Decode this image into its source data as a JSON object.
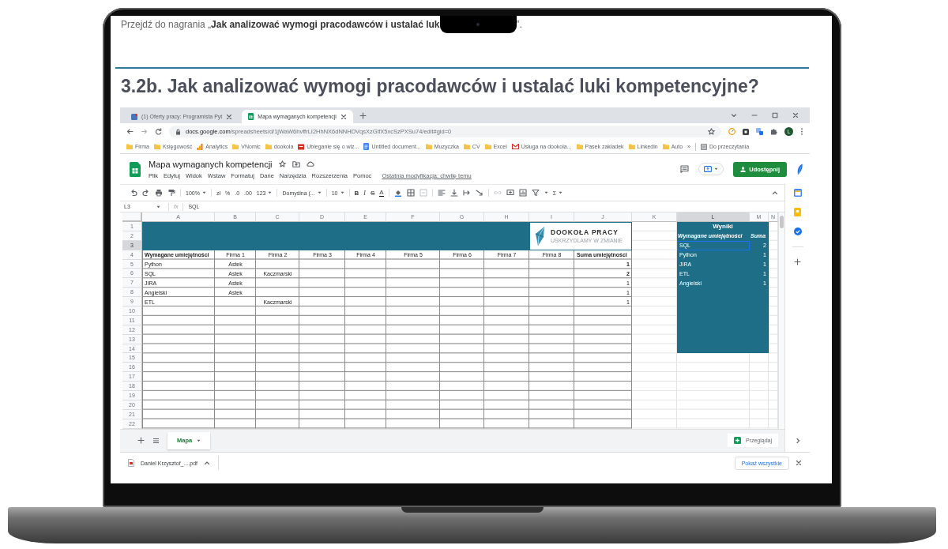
{
  "intro": {
    "text": "Przejdź do nagrania „**Jak analizować wymogi pracodawców i ustalać luk**",
    "end": "”."
  },
  "heading": "3.2b. Jak analizować wymogi pracodawców i ustalać luki kompetencyjne?",
  "browser": {
    "tabs": [
      {
        "title": "(1) Oferty pracy: Programista Pyt",
        "selected": false
      },
      {
        "title": "Mapa wymaganych kompetencji",
        "selected": true
      }
    ],
    "url": {
      "host": "docs.google.com",
      "path": "/spreadsheets/d/1jWaW6hvffrLI2HhNX6dNNHDVqsXzGlfX5xcSzPXSu74/edit#gid=0"
    },
    "profile_initial": "L",
    "bookmarks": [
      {
        "label": "Firma",
        "kind": "folder"
      },
      {
        "label": "Księgowość",
        "kind": "folder"
      },
      {
        "label": "Analytics",
        "kind": "analytics"
      },
      {
        "label": "VNomic",
        "kind": "folder"
      },
      {
        "label": "dookola",
        "kind": "folder"
      },
      {
        "label": "Ubieganie się o wiz...",
        "kind": "page"
      },
      {
        "label": "Untitled document...",
        "kind": "doc"
      },
      {
        "label": "Muzyczka",
        "kind": "folder"
      },
      {
        "label": "CV",
        "kind": "folder"
      },
      {
        "label": "Excel",
        "kind": "folder"
      },
      {
        "label": "Usługa na dookola...",
        "kind": "mail"
      },
      {
        "label": "Pasek zakładek",
        "kind": "folder"
      },
      {
        "label": "Linkedin",
        "kind": "folder"
      },
      {
        "label": "Auto",
        "kind": "folder"
      }
    ],
    "bookmarks_more": "»",
    "reading_list": "Do przeczytania"
  },
  "sheet": {
    "title": "Mapa wymaganych kompetencji",
    "menu": [
      "Plik",
      "Edytuj",
      "Widok",
      "Wstaw",
      "Formatuj",
      "Dane",
      "Narzędzia",
      "Rozszerzenia",
      "Pomoc"
    ],
    "last_edit": "Ostatnia modyfikacja: chwilę temu",
    "share": "Udostępnij",
    "toolbar": {
      "zoom": "100%",
      "currency": "zł",
      "percent": "%",
      "decimals_less": ".0",
      "decimals_more": ".00",
      "number_format": "123",
      "font": "Domyślna (...",
      "font_size": "10",
      "bold": "B",
      "italic": "I",
      "strikethrough": "S",
      "text_color": "A",
      "functions": "Σ"
    },
    "name_box": "L3",
    "formula_icon": "fx",
    "formula": "SQL",
    "columns": [
      {
        "label": "A",
        "selected": false
      },
      {
        "label": "B",
        "selected": false
      },
      {
        "label": "C",
        "selected": false
      },
      {
        "label": "D",
        "selected": false
      },
      {
        "label": "E",
        "selected": false
      },
      {
        "label": "F",
        "selected": false
      },
      {
        "label": "G",
        "selected": false
      },
      {
        "label": "H",
        "selected": false
      },
      {
        "label": "I",
        "selected": false
      },
      {
        "label": "J",
        "selected": false
      },
      {
        "label": "K",
        "selected": false
      },
      {
        "label": "L",
        "selected": true
      },
      {
        "label": "M",
        "selected": false
      },
      {
        "label": "N",
        "selected": false
      }
    ],
    "row_numbers": [
      {
        "label": "1",
        "selected": false
      },
      {
        "label": "2",
        "selected": false
      },
      {
        "label": "3",
        "selected": true
      },
      {
        "label": "4",
        "selected": false
      },
      {
        "label": "5",
        "selected": false
      },
      {
        "label": "6",
        "selected": false
      },
      {
        "label": "7",
        "selected": false
      },
      {
        "label": "8",
        "selected": false
      },
      {
        "label": "9",
        "selected": false
      },
      {
        "label": "10",
        "selected": false
      },
      {
        "label": "11",
        "selected": false
      },
      {
        "label": "12",
        "selected": false
      },
      {
        "label": "13",
        "selected": false
      },
      {
        "label": "14",
        "selected": false
      },
      {
        "label": "15",
        "selected": false
      },
      {
        "label": "16",
        "selected": false
      },
      {
        "label": "17",
        "selected": false
      },
      {
        "label": "18",
        "selected": false
      },
      {
        "label": "19",
        "selected": false
      },
      {
        "label": "20",
        "selected": false
      },
      {
        "label": "21",
        "selected": false
      },
      {
        "label": "22",
        "selected": false
      }
    ],
    "table": {
      "headers": [
        "Wymagane umiejętności",
        "Firma 1",
        "Firma 2",
        "Firma 3",
        "Firma 4",
        "Firma 5",
        "Firma 6",
        "Firma 7",
        "Firma 8",
        "Suma umiejętności"
      ],
      "rows": [
        {
          "skill": "Python",
          "firma_1": "Astek",
          "sum": "1",
          "sum_bold": true
        },
        {
          "skill": "SQL",
          "firma_1": "Astek",
          "firma_2": "Kaczmarski",
          "sum": "2",
          "sum_bold": true
        },
        {
          "skill": "JIRA",
          "firma_1": "Astek",
          "sum": "1",
          "sum_bold": false
        },
        {
          "skill": "Angielski",
          "firma_1": "Astek",
          "sum": "1",
          "sum_bold": false
        },
        {
          "skill": "ETL",
          "firma_2": "Kaczmarski",
          "sum": "1",
          "sum_bold": false
        }
      ]
    },
    "logo": {
      "name": "DOOKOŁA PRACY",
      "tagline": "USKRZYDLAMY W ZMIANIE"
    },
    "results": {
      "title": "Wyniki",
      "headers": [
        "Wymagane umiejętności",
        "Suma"
      ],
      "rows": [
        {
          "skill": "SQL",
          "sum": "2",
          "selected": true
        },
        {
          "skill": "Python",
          "sum": "1",
          "selected": false
        },
        {
          "skill": "JIRA",
          "sum": "1",
          "selected": false
        },
        {
          "skill": "ETL",
          "sum": "1",
          "selected": false
        },
        {
          "skill": "Angielski",
          "sum": "1",
          "selected": false
        }
      ]
    },
    "sheet_tabs": [
      {
        "label": "Mapa",
        "selected": true
      }
    ],
    "explore": "Przeglądaj"
  },
  "downloads": {
    "file": "Daniel Krzysztof_....pdf",
    "show_all": "Pokaż wszystkie"
  }
}
